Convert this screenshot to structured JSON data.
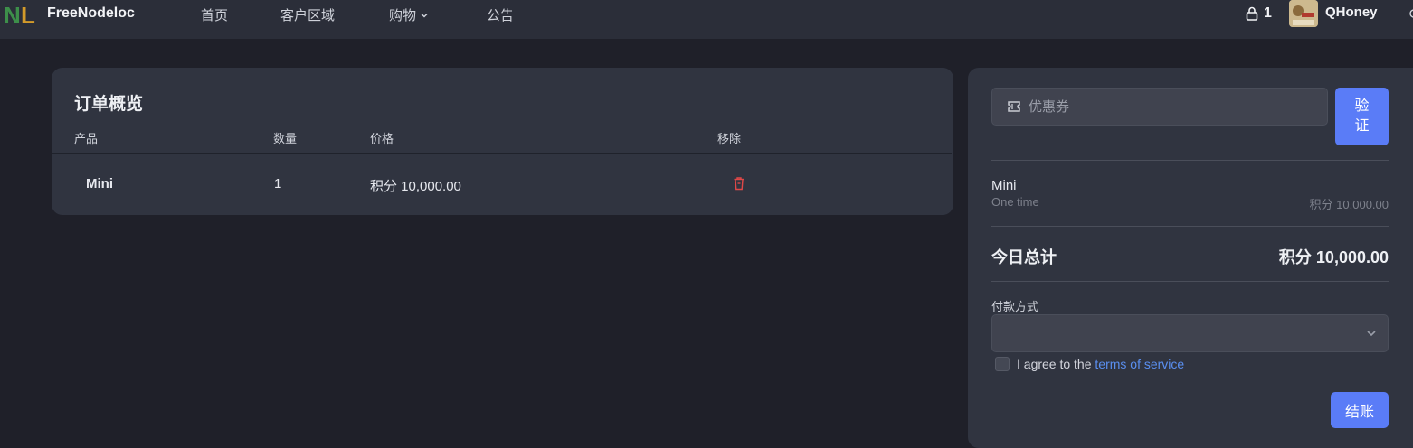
{
  "nav": {
    "brand": "FreeNodeloc",
    "items": [
      {
        "label": "首页"
      },
      {
        "label": "客户区域"
      },
      {
        "label": "购物"
      },
      {
        "label": "公告"
      }
    ],
    "cart_count": "1",
    "username": "QHoney",
    "logo_text": "NL"
  },
  "order": {
    "title": "订单概览",
    "columns": [
      "产品",
      "数量",
      "价格",
      "移除"
    ],
    "rows": [
      {
        "product": "Mini",
        "quantity": "1",
        "price": "积分 10,000.00"
      }
    ]
  },
  "summary": {
    "coupon_placeholder": "优惠券",
    "verify_label": "验证",
    "item_name": "Mini",
    "item_cycle": "One time",
    "item_price": "积分 10,000.00",
    "total_label": "今日总计",
    "total_value": "积分 10,000.00",
    "payment_label": "付款方式",
    "agree_text": "I agree to the ",
    "tos_link": "terms of service",
    "checkout_label": "结账"
  },
  "colors": {
    "background": "#1f2029",
    "card": "#303440",
    "accent": "#5a7cf7",
    "danger": "#e04848",
    "link": "#5a8ff0"
  }
}
